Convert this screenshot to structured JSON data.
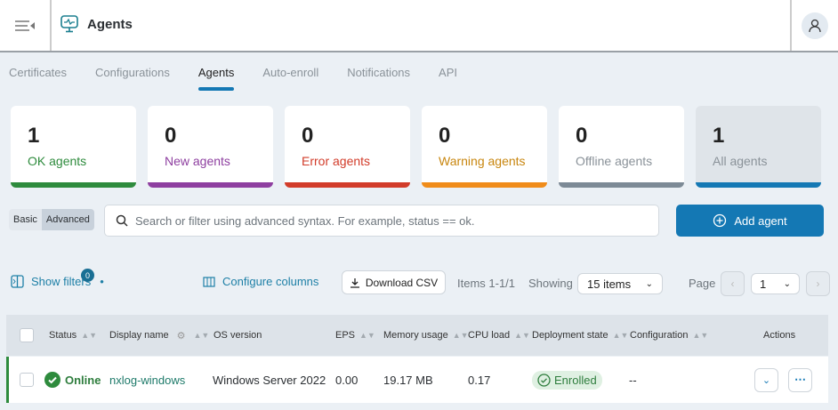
{
  "header": {
    "title": "Agents"
  },
  "tabs": [
    {
      "label": "Certificates"
    },
    {
      "label": "Configurations"
    },
    {
      "label": "Agents",
      "active": true
    },
    {
      "label": "Auto-enroll"
    },
    {
      "label": "Notifications"
    },
    {
      "label": "API"
    }
  ],
  "cards": [
    {
      "count": "1",
      "label": "OK agents",
      "color": "#2e8b3d"
    },
    {
      "count": "0",
      "label": "New agents",
      "color": "#8e3fa0"
    },
    {
      "count": "0",
      "label": "Error agents",
      "color": "#d23c2a"
    },
    {
      "count": "0",
      "label": "Warning agents",
      "color": "#f08c1a"
    },
    {
      "count": "0",
      "label": "Offline agents",
      "color": "#7d8a96"
    },
    {
      "count": "1",
      "label": "All agents",
      "color": "#1478b4"
    }
  ],
  "search": {
    "mode_basic": "Basic",
    "mode_advanced": "Advanced",
    "placeholder": "Search or filter using advanced syntax. For example, status == ok."
  },
  "add_agent": "Add agent",
  "toolbar": {
    "show_filters": "Show filters",
    "filter_count": "0",
    "configure_columns": "Configure columns",
    "download_csv": "Download CSV",
    "items": "Items 1-1/1",
    "showing": "Showing",
    "page_size": "15 items",
    "page_label": "Page",
    "page": "1"
  },
  "table": {
    "columns": [
      "Status",
      "Display name",
      "OS version",
      "EPS",
      "Memory usage",
      "CPU load",
      "Deployment state",
      "Configuration",
      "Actions"
    ],
    "rows": [
      {
        "status": "Online",
        "name": "nxlog-windows",
        "os": "Windows Server 2022",
        "eps": "0.00",
        "memory": "19.17 MB",
        "cpu": "0.17",
        "deployment": "Enrolled",
        "configuration": "--"
      }
    ]
  }
}
